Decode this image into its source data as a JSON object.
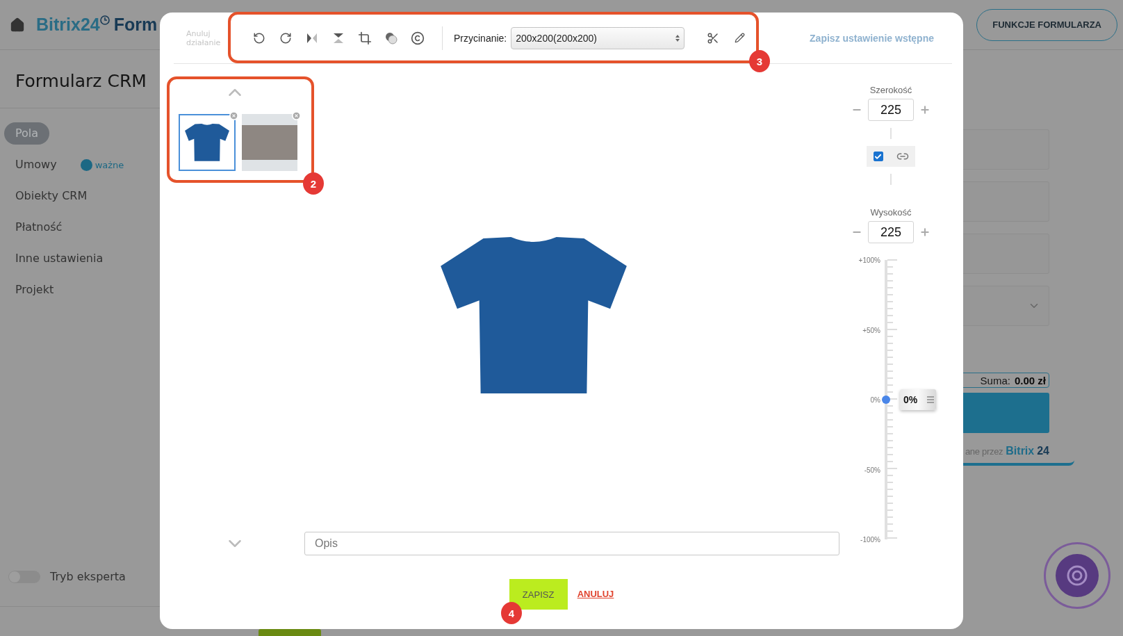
{
  "background_page": {
    "header": {
      "logo": "Bitrix24",
      "title": "Form",
      "features_button": "FUNKCJE FORMULARZA"
    },
    "sidebar": {
      "title": "Formularz CRM",
      "items": [
        {
          "label": "Pola",
          "selected": true
        },
        {
          "label": "Umowy",
          "selected": false,
          "badge": "ważne"
        },
        {
          "label": "Obiekty CRM",
          "selected": false
        },
        {
          "label": "Płatność",
          "selected": false
        },
        {
          "label": "Inne ustawienia",
          "selected": false
        },
        {
          "label": "Projekt",
          "selected": false
        }
      ],
      "expert_mode": {
        "label": "Tryb eksperta",
        "on": false
      }
    },
    "preview": {
      "total_label": "Suma:",
      "total_value": "0.00 zł",
      "footer_text": "ane przez",
      "footer_brand": "Bitrix",
      "footer_brand_number": "24"
    }
  },
  "editor": {
    "undo_label": "Anuluj działanie",
    "crop": {
      "label": "Przycinanie:",
      "value": "200x200(200x200)"
    },
    "save_preset": "Zapisz ustawienie wstępne",
    "thumbnails": [
      {
        "kind": "shirt",
        "selected": true
      },
      {
        "kind": "photo",
        "selected": false
      }
    ],
    "width": {
      "label": "Szerokość",
      "value": "225"
    },
    "height": {
      "label": "Wysokość",
      "value": "225"
    },
    "keep_ratio": {
      "checked": true
    },
    "scale": {
      "ticks": [
        "+100%",
        "+50%",
        "0%",
        "-50%",
        "-100%"
      ],
      "level": 0.5,
      "reading": "0%"
    },
    "description": {
      "placeholder": "Opis"
    },
    "buttons": {
      "save": "ZAPISZ",
      "cancel": "ANULUJ"
    }
  },
  "annotations": [
    {
      "number": "2"
    },
    {
      "number": "3"
    },
    {
      "number": "4"
    }
  ]
}
